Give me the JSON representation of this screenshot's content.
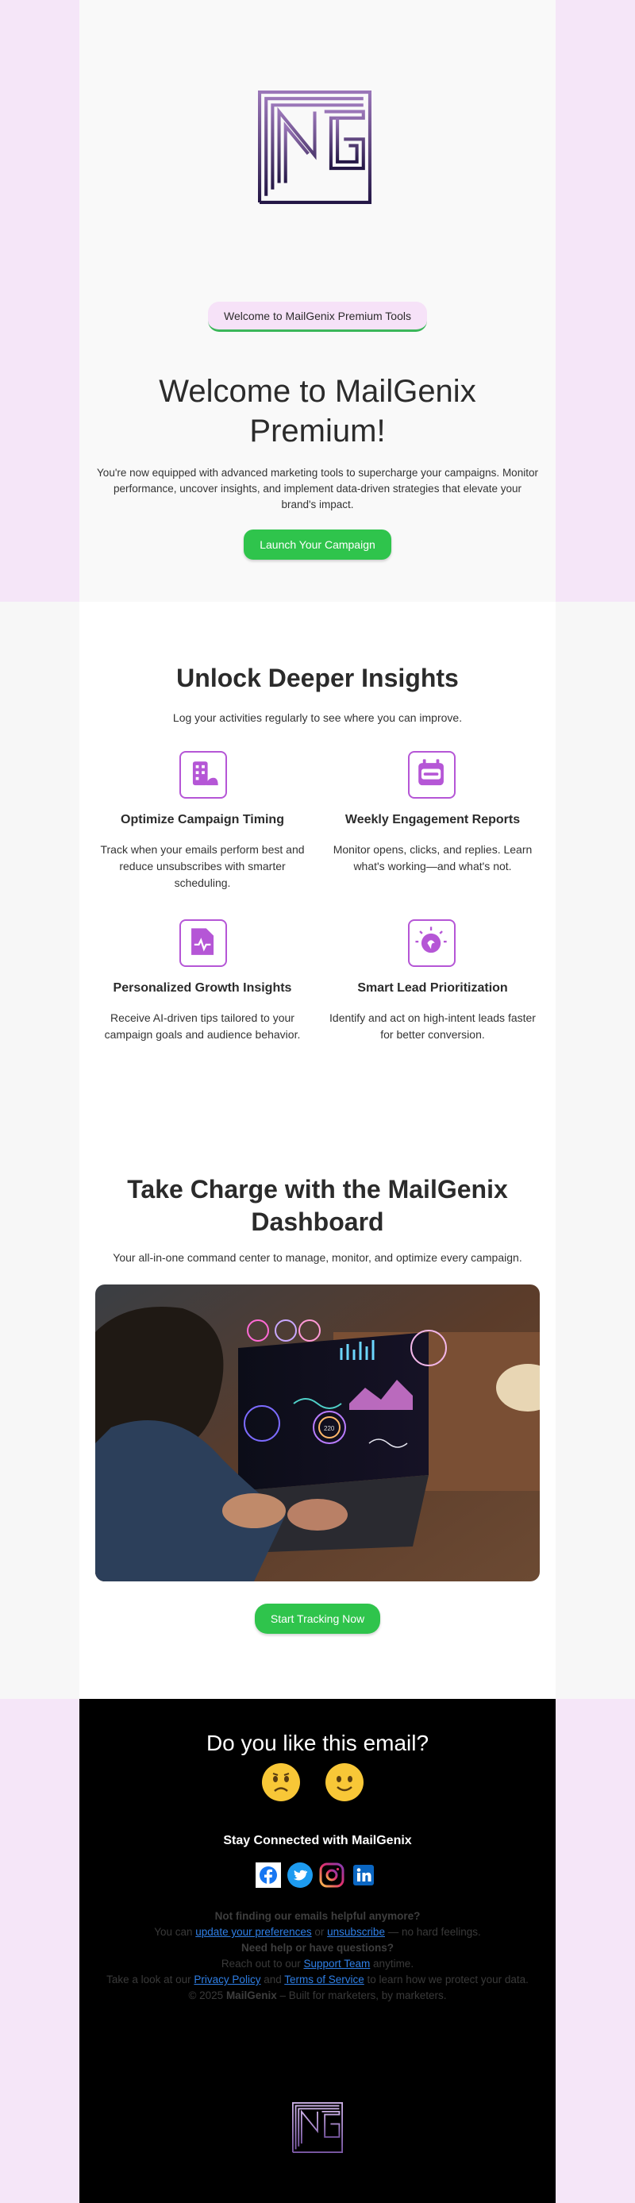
{
  "hero": {
    "logo_alt": "MG",
    "pill": "Welcome to MailGenix Premium Tools",
    "title": "Welcome to MailGenix Premium!",
    "subtitle": "You're now equipped with advanced marketing tools to supercharge your campaigns. Monitor performance, uncover insights, and implement data-driven strategies that elevate your brand's impact.",
    "button": "Launch Your Campaign"
  },
  "features": {
    "title": "Unlock Deeper Insights",
    "subtitle": "Log your activities regularly to see where you can improve.",
    "items": [
      {
        "icon": "timing-icon",
        "title": "Optimize Campaign Timing",
        "desc": "Track when your emails perform best and reduce unsubscribes with smarter scheduling."
      },
      {
        "icon": "report-icon",
        "title": "Weekly Engagement Reports",
        "desc": "Monitor opens, clicks, and replies. Learn what's working—and what's not."
      },
      {
        "icon": "growth-icon",
        "title": "Personalized Growth Insights",
        "desc": "Receive AI-driven tips tailored to your campaign goals and audience behavior."
      },
      {
        "icon": "lead-icon",
        "title": "Smart Lead Prioritization",
        "desc": "Identify and act on high-intent leads faster for better conversion."
      }
    ]
  },
  "dashboard": {
    "title": "Take Charge with the MailGenix Dashboard",
    "subtitle": "Your all-in-one command center to manage, monitor, and optimize every campaign.",
    "gauge_text": "220",
    "button": "Start Tracking Now"
  },
  "footer": {
    "question": "Do you like this email?",
    "stay": "Stay Connected with MailGenix",
    "social": [
      "facebook-icon",
      "twitter-icon",
      "instagram-icon",
      "linkedin-icon"
    ],
    "line1": "Not finding our emails helpful anymore?",
    "line2_pre": "You can ",
    "line2_link1": "update your preferences",
    "line2_mid": " or ",
    "line2_link2": "unsubscribe",
    "line2_post": " — no hard feelings.",
    "line3": "Need help or have questions?",
    "line4_pre": "Reach out to our ",
    "line4_link": "Support Team",
    "line4_post": " anytime.",
    "line5_pre": "Take a look at our ",
    "line5_link1": "Privacy Policy",
    "line5_mid": " and ",
    "line5_link2": "Terms of Service",
    "line5_post": " to learn how we protect your data.",
    "line6_pre": "© 2025 ",
    "line6_brand": "MailGenix",
    "line6_post": " – Built for marketers, by marketers."
  },
  "colors": {
    "accent_green": "#2fc44c",
    "brand_purple": "#b556d6",
    "band_pink": "#f5e6f8",
    "link_blue": "#2f7fe6"
  }
}
